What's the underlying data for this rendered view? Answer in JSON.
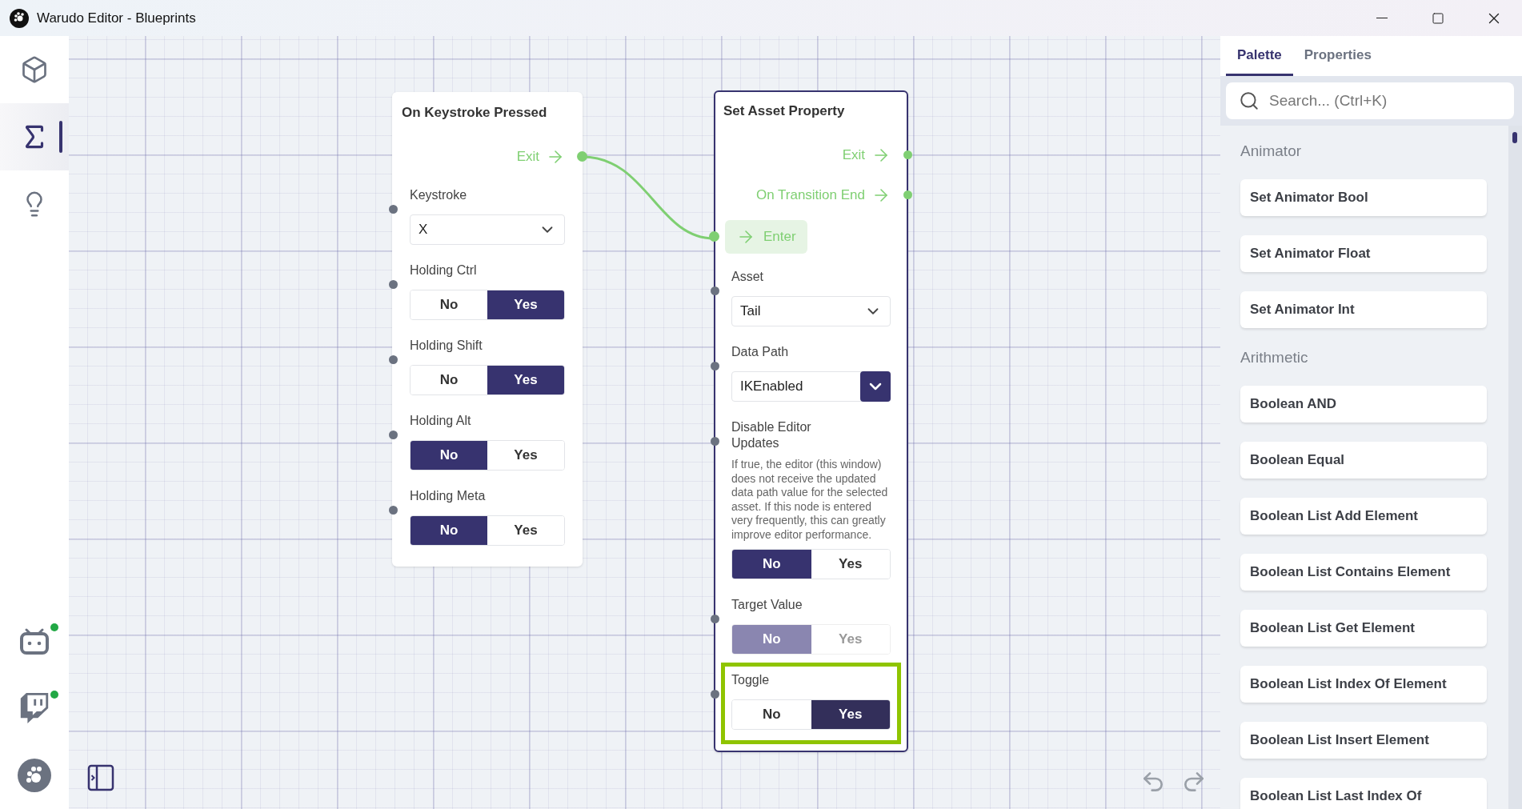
{
  "window": {
    "title": "Warudo Editor - Blueprints"
  },
  "sidebar": {
    "items": [
      {
        "kind": "cube",
        "selected": false
      },
      {
        "kind": "sigma",
        "selected": true
      },
      {
        "kind": "bulb",
        "selected": false
      }
    ],
    "services": [
      {
        "kind": "bilibili",
        "online": true
      },
      {
        "kind": "twitch",
        "online": true
      }
    ]
  },
  "canvas": {
    "nodes": [
      {
        "title": "On Keystroke Pressed",
        "selected": false,
        "outputs": [
          {
            "label": "Exit",
            "connected": true
          }
        ],
        "fields": [
          {
            "kind": "dropdown",
            "label": "Keystroke",
            "value": "X",
            "disabled": false,
            "highlighted": false
          },
          {
            "kind": "toggle",
            "label": "Holding Ctrl",
            "disabled": false,
            "highlighted": false,
            "options": [
              {
                "label": "No",
                "selected": false
              },
              {
                "label": "Yes",
                "selected": true
              }
            ]
          },
          {
            "kind": "toggle",
            "label": "Holding Shift",
            "disabled": false,
            "highlighted": false,
            "options": [
              {
                "label": "No",
                "selected": false
              },
              {
                "label": "Yes",
                "selected": true
              }
            ]
          },
          {
            "kind": "toggle",
            "label": "Holding Alt",
            "disabled": false,
            "highlighted": false,
            "options": [
              {
                "label": "No",
                "selected": true
              },
              {
                "label": "Yes",
                "selected": false
              }
            ]
          },
          {
            "kind": "toggle",
            "label": "Holding Meta",
            "disabled": false,
            "highlighted": false,
            "options": [
              {
                "label": "No",
                "selected": true
              },
              {
                "label": "Yes",
                "selected": false
              }
            ]
          }
        ]
      },
      {
        "title": "Set Asset Property",
        "selected": true,
        "outputs": [
          {
            "label": "Exit",
            "connected": false
          },
          {
            "label": "On Transition End",
            "connected": false
          }
        ],
        "inputs": [
          {
            "label": "Enter",
            "connected": true
          }
        ],
        "fields": [
          {
            "kind": "dropdown",
            "label": "Asset",
            "value": "Tail",
            "disabled": false,
            "highlighted": false
          },
          {
            "kind": "dropdown_button",
            "label": "Data Path",
            "value": "IKEnabled",
            "disabled": false,
            "highlighted": false
          },
          {
            "kind": "toggle",
            "label": "Disable Editor Updates",
            "description": "If true, the editor (this window) does not receive the updated data path value for the selected asset. If this node is entered very frequently, this can greatly improve editor performance.",
            "disabled": false,
            "highlighted": false,
            "options": [
              {
                "label": "No",
                "selected": true
              },
              {
                "label": "Yes",
                "selected": false
              }
            ]
          },
          {
            "kind": "toggle",
            "label": "Target Value",
            "disabled": true,
            "highlighted": false,
            "options": [
              {
                "label": "No",
                "selected": true
              },
              {
                "label": "Yes",
                "selected": false
              }
            ]
          },
          {
            "kind": "toggle",
            "label": "Toggle",
            "disabled": false,
            "highlighted": true,
            "options": [
              {
                "label": "No",
                "selected": false
              },
              {
                "label": "Yes",
                "selected": true
              }
            ]
          }
        ]
      }
    ]
  },
  "palette": {
    "tabs": [
      {
        "label": "Palette",
        "selected": true
      },
      {
        "label": "Properties",
        "selected": false
      }
    ],
    "search": {
      "placeholder": "Search... (Ctrl+K)"
    },
    "sections": [
      {
        "title": "Animator",
        "items": [
          "Set Animator Bool",
          "Set Animator Float",
          "Set Animator Int"
        ]
      },
      {
        "title": "Arithmetic",
        "items": [
          "Boolean AND",
          "Boolean Equal",
          "Boolean List Add Element",
          "Boolean List Contains Element",
          "Boolean List Get Element",
          "Boolean List Index Of Element",
          "Boolean List Insert Element",
          "Boolean List Last Index Of"
        ]
      }
    ]
  }
}
